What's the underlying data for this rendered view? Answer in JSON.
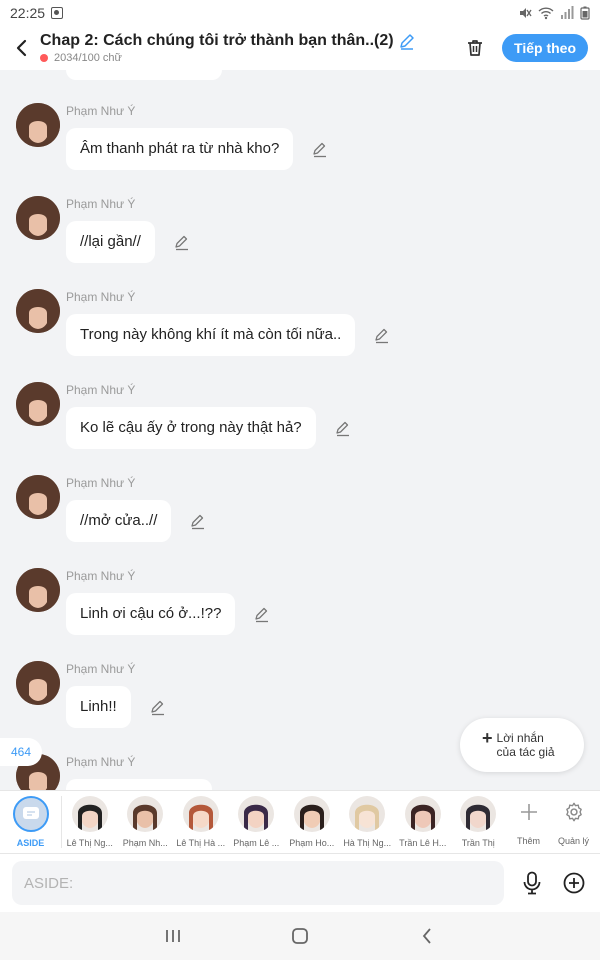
{
  "status_bar": {
    "time": "22:25"
  },
  "header": {
    "title": "Chap 2: Cách chúng tôi trở thành bạn thân..(2)",
    "word_count": "2034/100 chữ",
    "next_label": "Tiếp theo",
    "accent_color": "#3d9bf6"
  },
  "messages": [
    {
      "sender": "Phạm Như Ý",
      "text": "Âm thanh phát ra từ nhà kho?"
    },
    {
      "sender": "Phạm Như Ý",
      "text": "//lại gần//"
    },
    {
      "sender": "Phạm Như Ý",
      "text": "Trong này không khí ít mà còn tối nữa.."
    },
    {
      "sender": "Phạm Như Ý",
      "text": "Ko lẽ cậu ấy ở trong này thật hả?"
    },
    {
      "sender": "Phạm Như Ý",
      "text": "//mở cửa..//"
    },
    {
      "sender": "Phạm Như Ý",
      "text": "Linh ơi cậu có ở...!??"
    },
    {
      "sender": "Phạm Như Ý",
      "text": "Linh!!"
    },
    {
      "sender": "Phạm Như Ý",
      "text": ""
    }
  ],
  "message_counter": "464",
  "author_note": {
    "label_line1": "Lời nhắn",
    "label_line2": "của tác giả"
  },
  "characters_bar": {
    "aside_label": "ASIDE",
    "characters": [
      {
        "name": "Lê Thị Ng...",
        "hair": "#222222",
        "skin": "#f3d6c6"
      },
      {
        "name": "Phạm Nh...",
        "hair": "#5a3a2c",
        "skin": "#e9c0a8"
      },
      {
        "name": "Lê Thị Hà ...",
        "hair": "#b4583a",
        "skin": "#f6d9c8"
      },
      {
        "name": "Phạm Lê ...",
        "hair": "#3a2a48",
        "skin": "#f3d3c3"
      },
      {
        "name": "Phạm Ho...",
        "hair": "#2a1f1c",
        "skin": "#f0ccb5"
      },
      {
        "name": "Hà Thị Ng...",
        "hair": "#e0c9a2",
        "skin": "#f7e3d5"
      },
      {
        "name": "Trần Lê H...",
        "hair": "#3b2424",
        "skin": "#eec8b8"
      },
      {
        "name": "Trần Thị",
        "hair": "#2e2a33",
        "skin": "#f1d7cc"
      }
    ],
    "add_label": "Thêm",
    "manage_label": "Quản lý"
  },
  "input": {
    "placeholder": "ASIDE:"
  }
}
